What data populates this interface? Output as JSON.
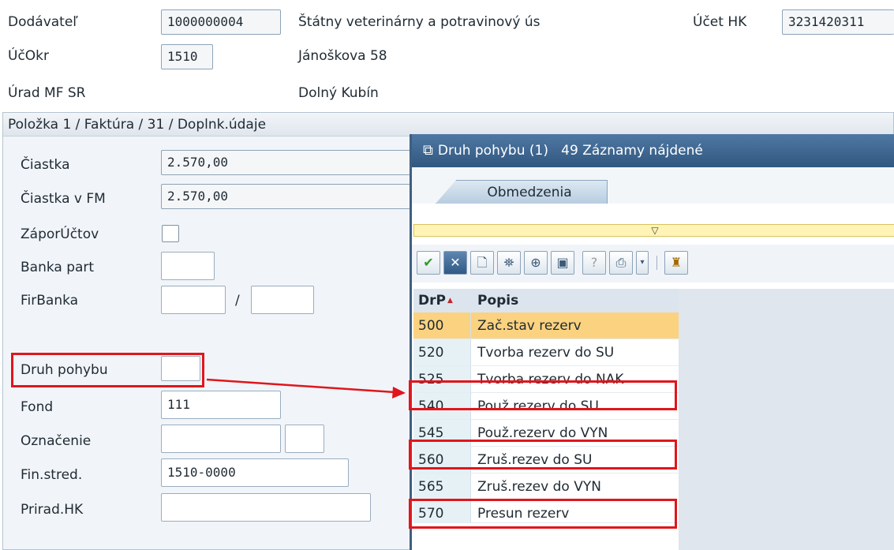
{
  "header": {
    "vendor_label": "Dodávateľ",
    "vendor_id": "1000000004",
    "vendor_name": "Štátny veterinárny a potravinový ús",
    "gl_label": "Účet HK",
    "gl_value": "3231420311",
    "acct_label": "ÚčOkr",
    "acct_value": "1510",
    "street": "Jánoškova 58",
    "office": "Úrad MF SR",
    "city": "Dolný Kubín"
  },
  "item_panel": {
    "title": "Položka 1 / Faktúra / 31 / Doplnk.údaje",
    "fields": {
      "ciastka_label": "Čiastka",
      "ciastka_value": "2.570,00",
      "ciastka_fm_label": "Čiastka v FM",
      "ciastka_fm_value": "2.570,00",
      "zapor_label": "ZáporÚčtov",
      "banka_label": "Banka part",
      "firbanka_label": "FirBanka",
      "firbanka_sep": "/",
      "druh_label": "Druh pohybu",
      "fond_label": "Fond",
      "fond_value": "111",
      "oznacenie_label": "Označenie",
      "finstred_label": "Fin.stred.",
      "finstred_value": "1510-0000",
      "prirad_label": "Prirad.HK"
    }
  },
  "dialog": {
    "title": "Druh pohybu (1)   49 Záznamy nájdené",
    "tab_label": "Obmedzenia",
    "collapse_glyph": "▽",
    "toolbar_icons": [
      "check-icon",
      "cancel-icon",
      "new-page-icon",
      "find-icon",
      "find-next-icon",
      "select-icon",
      "help-icon",
      "print-icon",
      "dropdown-icon",
      "pin-icon"
    ],
    "table": {
      "headers": [
        "DrP",
        "Popis"
      ],
      "sort_indicator": "▲",
      "rows": [
        {
          "code": "500",
          "desc": "Zač.stav rezerv",
          "selected": true
        },
        {
          "code": "520",
          "desc": "Tvorba rezerv do SU"
        },
        {
          "code": "525",
          "desc": "Tvorba rezerv do NAK"
        },
        {
          "code": "540",
          "desc": "Použ.rezerv do SU"
        },
        {
          "code": "545",
          "desc": "Použ.rezerv do VYN"
        },
        {
          "code": "560",
          "desc": "Zruš.rezev do SU"
        },
        {
          "code": "565",
          "desc": "Zruš.rezev do VYN"
        },
        {
          "code": "570",
          "desc": "Presun rezerv"
        }
      ]
    }
  },
  "colors": {
    "highlight": "#e0161c",
    "title_bar": "#3b6590",
    "selected_row": "#fbd27f",
    "collapse_bar": "#fff4b5"
  }
}
